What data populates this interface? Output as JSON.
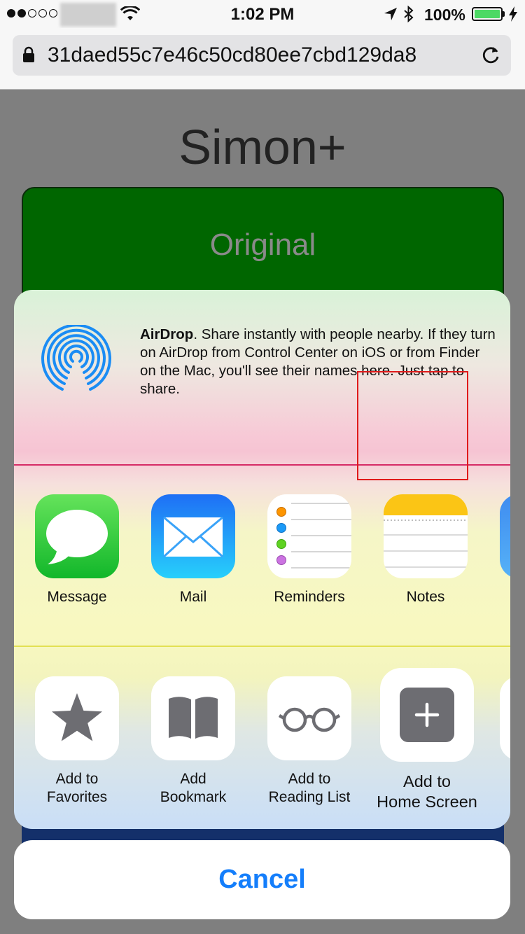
{
  "status_bar": {
    "time": "1:02 PM",
    "battery_percent": "100%",
    "battery_color": "#4cd964",
    "icons": [
      "signal-dots-icon",
      "wifi-icon",
      "location-arrow-icon",
      "bluetooth-icon",
      "battery-icon",
      "charging-bolt-icon"
    ]
  },
  "browser": {
    "url": "31daed55c7e46c50cd80ee7cbd129da8",
    "icons": [
      "lock-icon",
      "reload-icon"
    ]
  },
  "page": {
    "title": "Simon+",
    "card_title": "Original",
    "card_color": "#006600"
  },
  "share_sheet": {
    "airdrop": {
      "title": "AirDrop",
      "description": ". Share instantly with people nearby. If they turn on AirDrop from Control Center on iOS or from Finder on the Mac, you'll see their names here. Just tap to share."
    },
    "apps": [
      {
        "label": "Message",
        "icon": "messages-app-icon"
      },
      {
        "label": "Mail",
        "icon": "mail-app-icon"
      },
      {
        "label": "Reminders",
        "icon": "reminders-app-icon"
      },
      {
        "label": "Notes",
        "icon": "notes-app-icon"
      }
    ],
    "actions": [
      {
        "label_line1": "Add to",
        "label_line2": "Favorites",
        "icon": "star-icon"
      },
      {
        "label_line1": "Add",
        "label_line2": "Bookmark",
        "icon": "book-icon"
      },
      {
        "label_line1": "Add to",
        "label_line2": "Reading List",
        "icon": "glasses-icon"
      },
      {
        "label_line1": "Add to",
        "label_line2": "Home Screen",
        "icon": "plus-square-icon"
      }
    ],
    "highlight_color": "#e01a1a"
  },
  "cancel_label": "Cancel"
}
